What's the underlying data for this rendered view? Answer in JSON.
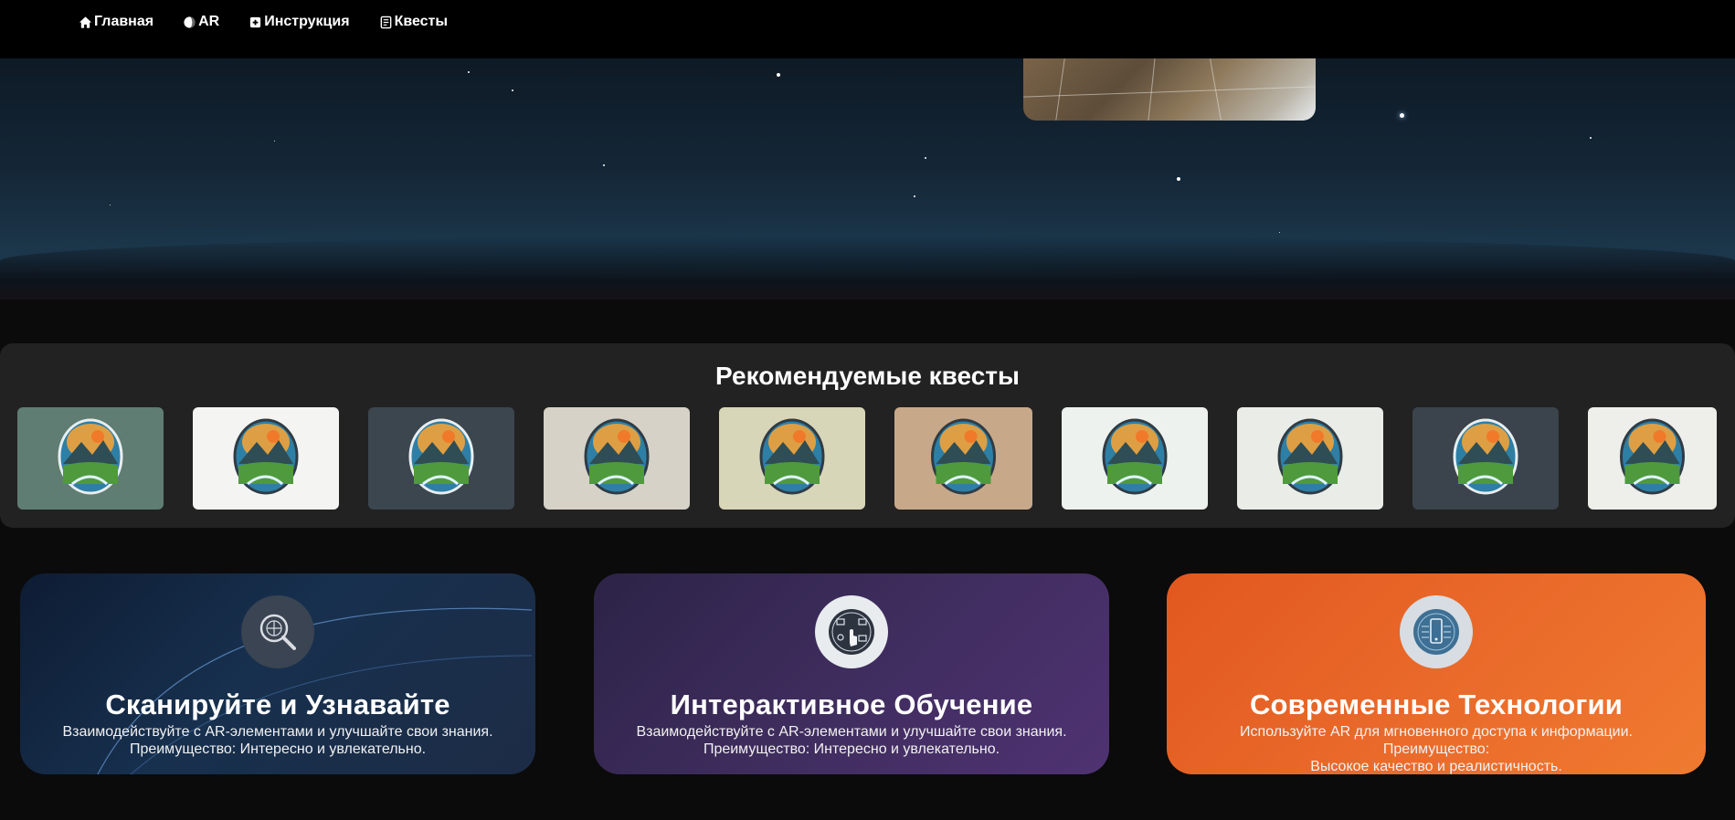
{
  "nav": {
    "items": [
      {
        "label": "Главная",
        "icon": "home-icon"
      },
      {
        "label": "AR",
        "icon": "ar-circle-icon"
      },
      {
        "label": "Инструкция",
        "icon": "instruction-icon"
      },
      {
        "label": "Квесты",
        "icon": "quests-icon"
      }
    ]
  },
  "recommended": {
    "title": "Рекомендуемые квесты",
    "cards": [
      {
        "logo": "travel-company-logo",
        "bg": "#5f7d72"
      },
      {
        "logo": "company-mountains-logo",
        "bg": "#f4f4f2"
      },
      {
        "logo": "river-balloon-logo",
        "bg": "#3c464f"
      },
      {
        "logo": "travel-company-badge-logo",
        "bg": "#d6d2c8"
      },
      {
        "logo": "travel-sunset-logo",
        "bg": "#d8d6b8"
      },
      {
        "logo": "compry-company-logo",
        "bg": "#c7a98a"
      },
      {
        "logo": "travel-company-forest-logo",
        "bg": "#eef2ee"
      },
      {
        "logo": "sun-plane-river-logo",
        "bg": "#e9ece7"
      },
      {
        "logo": "mountain-river-badge-logo",
        "bg": "#3b444c"
      },
      {
        "logo": "laurel-river-logo",
        "bg": "#eeeeea"
      }
    ]
  },
  "features": [
    {
      "title": "Сканируйте и Узнавайте",
      "desc_1": "Взаимодействуйте с AR-элементами и улучшайте свои знания.",
      "desc_2": "Преимущество: Интересно и увлекательно.",
      "icon": "scan-search-icon"
    },
    {
      "title": "Интерактивное Обучение",
      "desc_1": "Взаимодействуйте с AR-элементами и улучшайте свои знания.",
      "desc_2": "Преимущество: Интересно и увлекательно.",
      "icon": "interactive-touch-icon"
    },
    {
      "title": "Современные Технологии",
      "desc_1": "Используйте AR для мгновенного доступа к информации. Преимущество:",
      "desc_2": "Высокое качество и реалистичность.",
      "icon": "tech-device-icon"
    }
  ]
}
